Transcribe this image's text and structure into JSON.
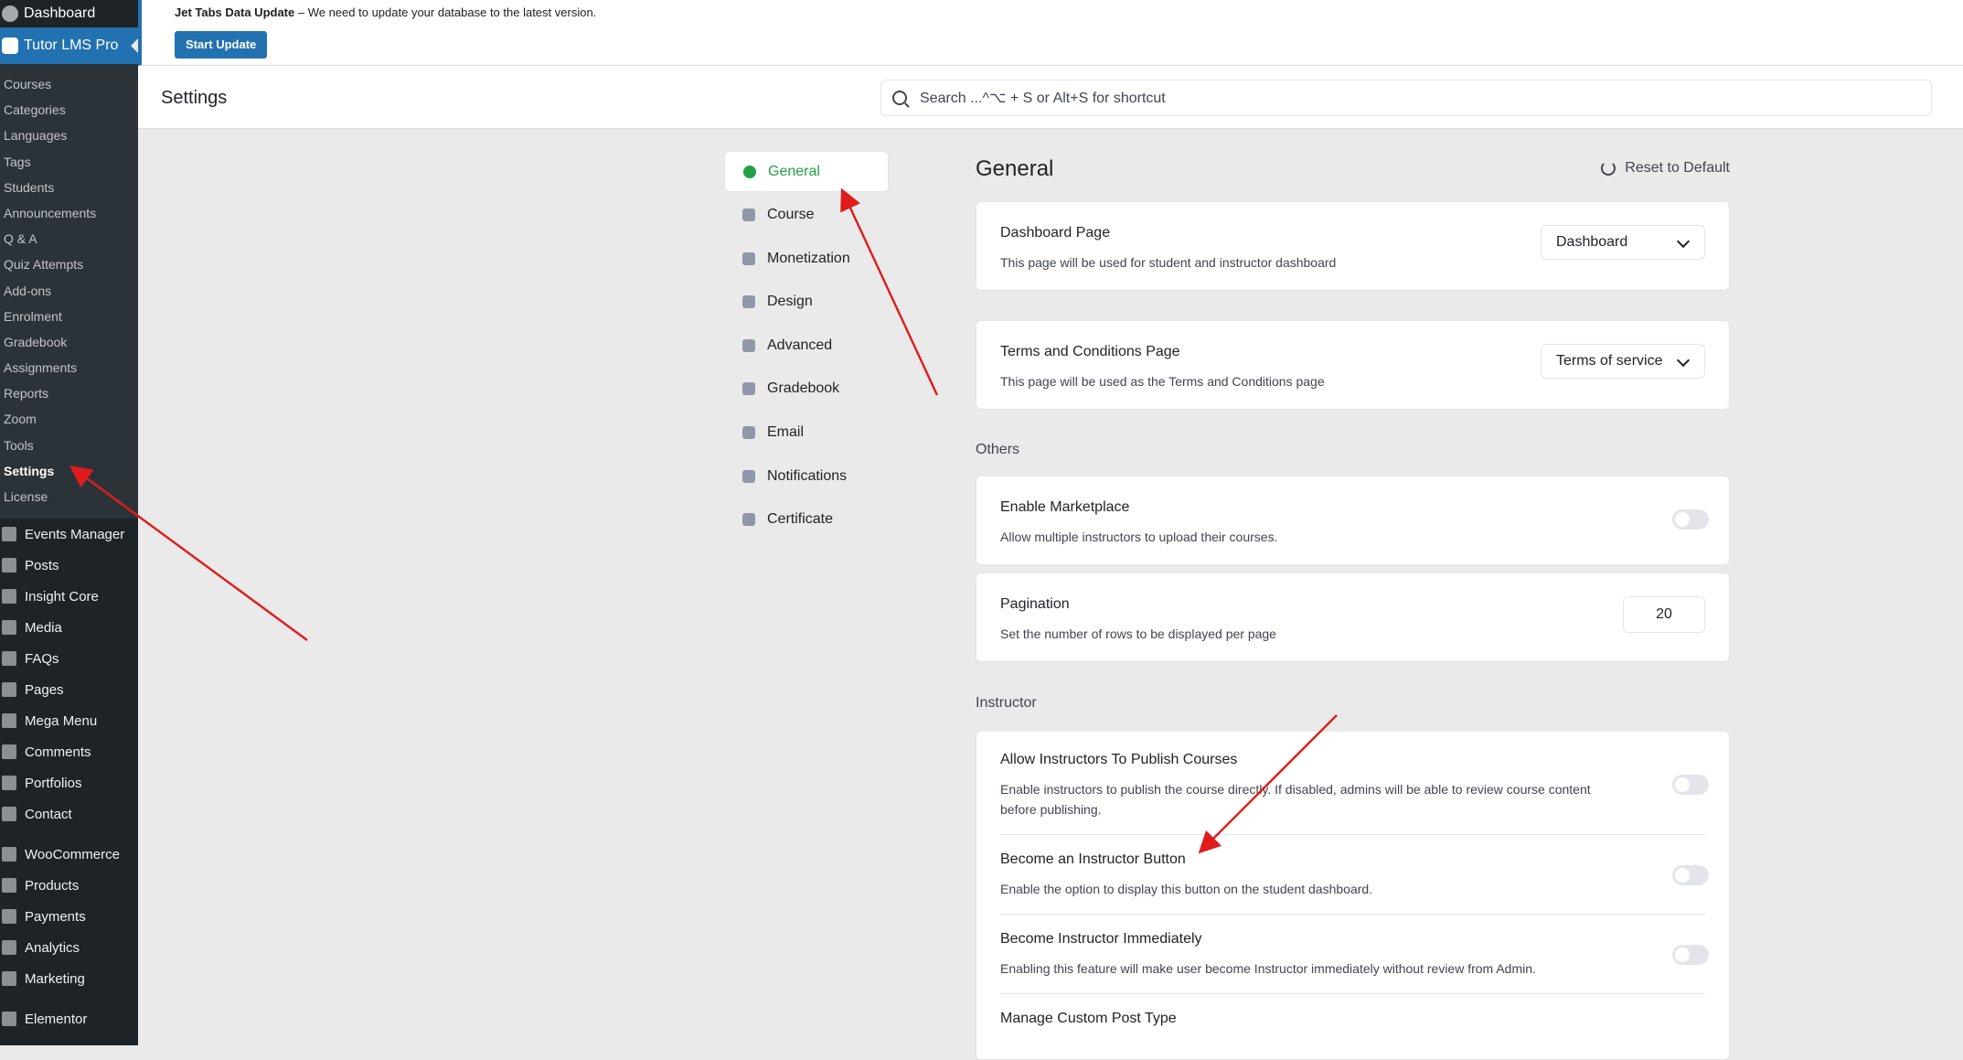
{
  "wp_sidebar": {
    "top_item": "Dashboard",
    "current_item": "Tutor LMS Pro",
    "submenu": [
      "Courses",
      "Categories",
      "Languages",
      "Tags",
      "Students",
      "Announcements",
      "Q & A",
      "Quiz Attempts",
      "Add-ons",
      "Enrolment",
      "Gradebook",
      "Assignments",
      "Reports",
      "Zoom",
      "Tools",
      "Settings",
      "License"
    ],
    "submenu_active": "Settings",
    "menu_group1": [
      {
        "label": "Events Manager",
        "icon": "calendar-icon"
      },
      {
        "label": "Posts",
        "icon": "pin-icon"
      },
      {
        "label": "Insight Core",
        "icon": "insight-icon"
      },
      {
        "label": "Media",
        "icon": "media-icon"
      },
      {
        "label": "FAQs",
        "icon": "faq-icon"
      },
      {
        "label": "Pages",
        "icon": "pages-icon"
      },
      {
        "label": "Mega Menu",
        "icon": "menu-icon"
      },
      {
        "label": "Comments",
        "icon": "comment-icon"
      },
      {
        "label": "Portfolios",
        "icon": "folder-icon"
      },
      {
        "label": "Contact",
        "icon": "mail-icon"
      }
    ],
    "menu_group2": [
      {
        "label": "WooCommerce",
        "icon": "woo-icon"
      },
      {
        "label": "Products",
        "icon": "box-icon"
      },
      {
        "label": "Payments",
        "icon": "dollar-icon"
      },
      {
        "label": "Analytics",
        "icon": "chart-icon"
      },
      {
        "label": "Marketing",
        "icon": "megaphone-icon"
      }
    ],
    "menu_group3": [
      {
        "label": "Elementor",
        "icon": "elementor-icon"
      }
    ]
  },
  "notice": {
    "title": "Jet Tabs Data Update",
    "message": " – We need to update your database to the latest version.",
    "button": "Start Update"
  },
  "header": {
    "title": "Settings",
    "search_placeholder": "Search ...^⌥ + S or Alt+S for shortcut"
  },
  "nav": {
    "items": [
      {
        "label": "General",
        "icon": "globe-icon",
        "active": true
      },
      {
        "label": "Course",
        "icon": "book-icon"
      },
      {
        "label": "Monetization",
        "icon": "money-icon"
      },
      {
        "label": "Design",
        "icon": "palette-icon"
      },
      {
        "label": "Advanced",
        "icon": "filter-icon"
      },
      {
        "label": "Gradebook",
        "icon": "gradebook-icon"
      },
      {
        "label": "Email",
        "icon": "email-icon"
      },
      {
        "label": "Notifications",
        "icon": "bell-icon"
      },
      {
        "label": "Certificate",
        "icon": "certificate-icon"
      }
    ]
  },
  "content": {
    "title": "General",
    "reset": "Reset to Default",
    "dashboard_page": {
      "title": "Dashboard Page",
      "desc": "This page will be used for student and instructor dashboard",
      "value": "Dashboard"
    },
    "terms_page": {
      "title": "Terms and Conditions Page",
      "desc": "This page will be used as the Terms and Conditions page",
      "value": "Terms of service"
    },
    "others_label": "Others",
    "marketplace": {
      "title": "Enable Marketplace",
      "desc": "Allow multiple instructors to upload their courses.",
      "enabled": false
    },
    "pagination": {
      "title": "Pagination",
      "desc": "Set the number of rows to be displayed per page",
      "value": "20"
    },
    "instructor_label": "Instructor",
    "instructor_rows": [
      {
        "title": "Allow Instructors To Publish Courses",
        "desc": "Enable instructors to publish the course directly. If disabled, admins will be able to review course content before publishing.",
        "enabled": false
      },
      {
        "title": "Become an Instructor Button",
        "desc": "Enable the option to display this button on the student dashboard.",
        "enabled": false
      },
      {
        "title": "Become Instructor Immediately",
        "desc": "Enabling this feature will make user become Instructor immediately without review from Admin.",
        "enabled": false
      },
      {
        "title": "Manage Custom Post Type",
        "desc": "",
        "enabled": false
      }
    ]
  },
  "annotation_color": "#e01b1b"
}
